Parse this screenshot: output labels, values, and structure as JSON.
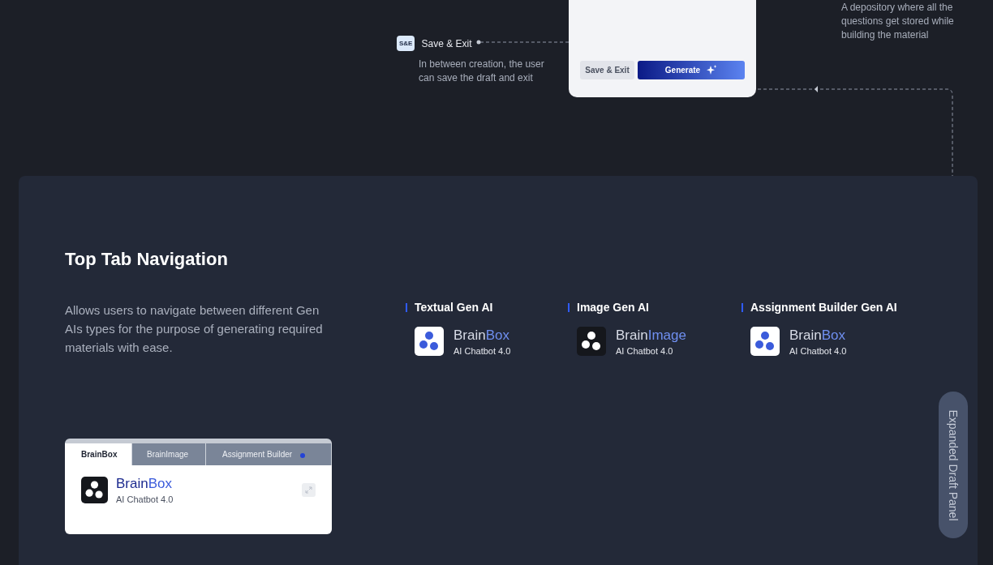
{
  "save_exit_note": {
    "badge": "S&E",
    "title": "Save & Exit",
    "description": "In between creation, the user can save the draft and exit"
  },
  "draft_card": {
    "buttons": [
      {
        "label": "Save & Exit",
        "kind": "secondary"
      },
      {
        "label": "Generate",
        "kind": "primary"
      }
    ]
  },
  "depository_note": {
    "description": "A depository where all the questions get stored while building the material"
  },
  "section": {
    "title": "Top Tab Navigation",
    "description": "Allows users to navigate between different Gen AIs types for the purpose of generating required materials with ease.",
    "categories": [
      {
        "heading": "Textual Gen AI",
        "brand": "Brain",
        "product": "Box",
        "subtitle": "AI Chatbot 4.0",
        "dark_icon": false
      },
      {
        "heading": "Image Gen AI",
        "brand": "Brain",
        "product": "Image",
        "subtitle": "AI Chatbot 4.0",
        "dark_icon": true
      },
      {
        "heading": "Assignment Builder Gen AI",
        "brand": "Brain",
        "product": "Box",
        "subtitle": "AI Chatbot 4.0",
        "dark_icon": false
      }
    ]
  },
  "tab_preview": {
    "tabs": [
      {
        "label": "BrainBox",
        "selected": true,
        "notification": false
      },
      {
        "label": "BrainImage",
        "selected": false,
        "notification": false
      },
      {
        "label": "Assignment Builder",
        "selected": false,
        "notification": true
      }
    ],
    "brand": "Brain",
    "product": "Box",
    "subtitle": "AI Chatbot 4.0"
  },
  "side_panel": {
    "label": "Expanded Draft Panel"
  }
}
